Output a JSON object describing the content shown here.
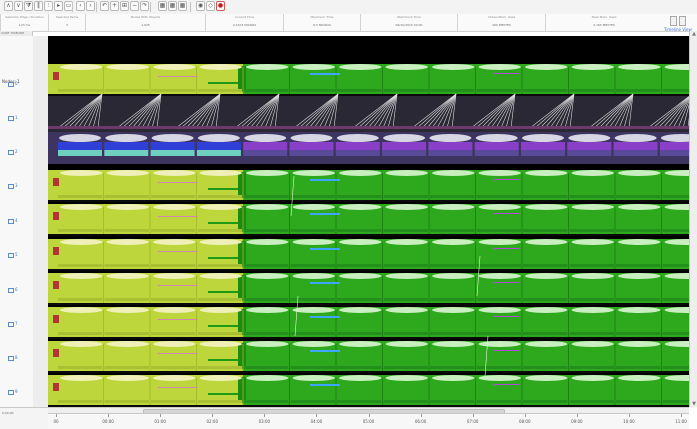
{
  "toolbar": {
    "buttons": [
      {
        "name": "collapse-all-icon",
        "glyph": "∧"
      },
      {
        "name": "expand-all-icon",
        "glyph": "∨"
      },
      {
        "name": "filter-icon",
        "glyph": "⧩"
      },
      {
        "name": "pause-icon",
        "glyph": "‖"
      },
      {
        "name": "step-icon",
        "glyph": "⫶"
      },
      {
        "name": "record-step-icon",
        "glyph": "▸"
      },
      {
        "name": "frame-icon",
        "glyph": "▭"
      },
      {
        "name": "prev-icon",
        "glyph": "‹"
      },
      {
        "name": "next-icon",
        "glyph": "›"
      },
      {
        "name": "undo-zoom-icon",
        "glyph": "↶"
      },
      {
        "name": "zoom-in-icon",
        "glyph": "+"
      },
      {
        "name": "zoom-fit-icon",
        "glyph": "⊞"
      },
      {
        "name": "zoom-out-icon",
        "glyph": "−"
      },
      {
        "name": "redo-zoom-icon",
        "glyph": "↷"
      },
      {
        "name": "grid-a-icon",
        "glyph": "▦"
      },
      {
        "name": "grid-b-icon",
        "glyph": "▦"
      },
      {
        "name": "grid-c-icon",
        "glyph": "▦"
      },
      {
        "name": "eye-icon",
        "glyph": "◉"
      },
      {
        "name": "bookmark-icon",
        "glyph": "◇"
      },
      {
        "name": "record-icon",
        "glyph": "●"
      }
    ]
  },
  "status": {
    "cells": [
      {
        "label": "Selection Edge / Duration",
        "value": "123 ms"
      },
      {
        "label": "Selected Items",
        "value": "3"
      },
      {
        "label": "Nodes With Objects",
        "value": "1,025"
      },
      {
        "label": "Current Time",
        "value": "2.2103 MICROS"
      },
      {
        "label": "Maximum Time",
        "value": "6.5 MICROS"
      },
      {
        "label": "Wall Clock Time",
        "value": "06/10/2010 00:00"
      },
      {
        "label": "Virtual Mem. Used",
        "value": "400 MBYTES"
      },
      {
        "label": "Peak Mem. Used",
        "value": "2,165 MBYTES"
      }
    ],
    "timeline_link": "Timeline View",
    "left_header": "CORE TIMELINE"
  },
  "tree": {
    "root_label": "Nodes: 1",
    "rows": [
      "0",
      "1",
      "2",
      "3",
      "4",
      "5",
      "6",
      "7",
      "8",
      "9"
    ]
  },
  "axis": {
    "ticks": [
      "00",
      "00:00",
      "01:00",
      "02:00",
      "03:00",
      "04:00",
      "05:00",
      "06:00",
      "07:00",
      "08:00",
      "09:00",
      "10:00",
      "11:00"
    ],
    "left_time": "0:00:00"
  },
  "colors": {
    "track_background": "#000000",
    "early_phase": "#bdd63c",
    "late_phase": "#2ea81c",
    "late_phase_dark": "#1d8a10",
    "bar_highlight_blue": "#3fa6ff",
    "bar_highlight_purple": "#b24cd8",
    "marker_red": "#b33434",
    "band_pink": "#d08ab0"
  }
}
